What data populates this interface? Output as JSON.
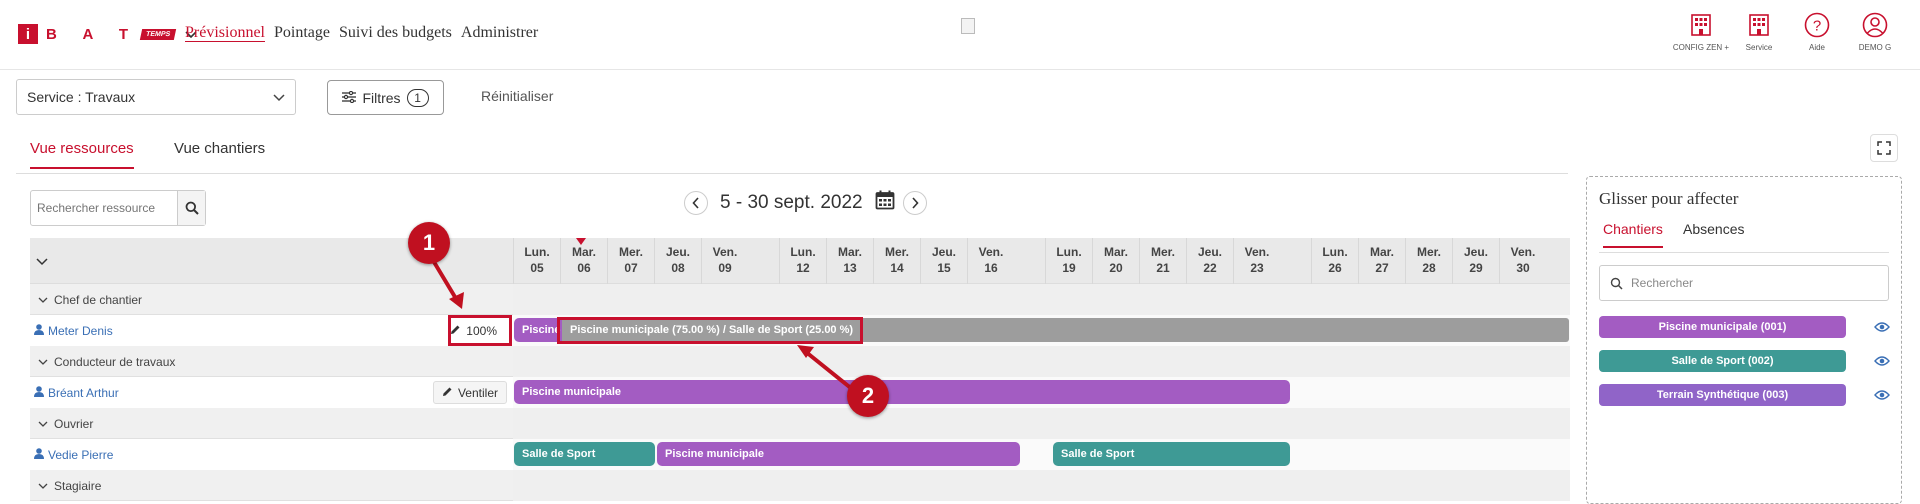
{
  "header": {
    "logo": {
      "letter": "i",
      "brand": "B A T",
      "tag": "TEMPS"
    },
    "nav": [
      "Prévisionnel",
      "Pointage",
      "Suivi des budgets",
      "Administrer"
    ],
    "icons": [
      {
        "name": "config-icon",
        "label": "CONFIG ZEN +"
      },
      {
        "name": "service-icon",
        "label": "Service"
      },
      {
        "name": "help-icon",
        "label": "Aide"
      },
      {
        "name": "user-icon",
        "label": "DEMO G"
      }
    ]
  },
  "filters": {
    "service_value": "Service : Travaux",
    "filtres_label": "Filtres",
    "filtres_count": "1",
    "reinit_label": "Réinitialiser"
  },
  "tabs": [
    "Vue ressources",
    "Vue chantiers"
  ],
  "resource_search": {
    "placeholder": "Rechercher ressource"
  },
  "date_range": "5 - 30 sept. 2022",
  "days": [
    {
      "d": "Lun.",
      "n": "05"
    },
    {
      "d": "Mar.",
      "n": "06"
    },
    {
      "d": "Mer.",
      "n": "07"
    },
    {
      "d": "Jeu.",
      "n": "08"
    },
    {
      "d": "Ven.",
      "n": "09"
    },
    {
      "d": "Lun.",
      "n": "12"
    },
    {
      "d": "Mar.",
      "n": "13"
    },
    {
      "d": "Mer.",
      "n": "14"
    },
    {
      "d": "Jeu.",
      "n": "15"
    },
    {
      "d": "Ven.",
      "n": "16"
    },
    {
      "d": "Lun.",
      "n": "19"
    },
    {
      "d": "Mar.",
      "n": "20"
    },
    {
      "d": "Mer.",
      "n": "21"
    },
    {
      "d": "Jeu.",
      "n": "22"
    },
    {
      "d": "Ven.",
      "n": "23"
    },
    {
      "d": "Lun.",
      "n": "26"
    },
    {
      "d": "Mar.",
      "n": "27"
    },
    {
      "d": "Mer.",
      "n": "28"
    },
    {
      "d": "Jeu.",
      "n": "29"
    },
    {
      "d": "Ven.",
      "n": "30"
    }
  ],
  "rows": {
    "group1": "Chef de chantier",
    "res1": {
      "name": "Meter Denis",
      "pct": "100%",
      "bar_a": "Piscine",
      "bar_b": "Piscine municipale (75.00 %) / Salle de Sport (25.00 %)"
    },
    "group2": "Conducteur de travaux",
    "res2": {
      "name": "Bréant Arthur",
      "action": "Ventiler",
      "bar_a": "Piscine municipale"
    },
    "group3": "Ouvrier",
    "res3": {
      "name": "Vedie Pierre",
      "bar_a": "Salle de Sport",
      "bar_b": "Piscine municipale",
      "bar_c": "Salle de Sport"
    },
    "group4": "Stagiaire"
  },
  "annotations": {
    "c1": "1",
    "c2": "2"
  },
  "side_panel": {
    "title": "Glisser pour affecter",
    "tabs": [
      "Chantiers",
      "Absences"
    ],
    "search_placeholder": "Rechercher",
    "items": [
      "Piscine municipale (001)",
      "Salle de Sport (002)",
      "Terrain Synthétique (003)"
    ]
  },
  "colors": {
    "accent": "#c8102e",
    "violet": "#a35cc2",
    "teal": "#3e9a95",
    "lavender": "#9064c8",
    "gray_bar": "#9d9d9d",
    "link": "#3a6fb5"
  }
}
